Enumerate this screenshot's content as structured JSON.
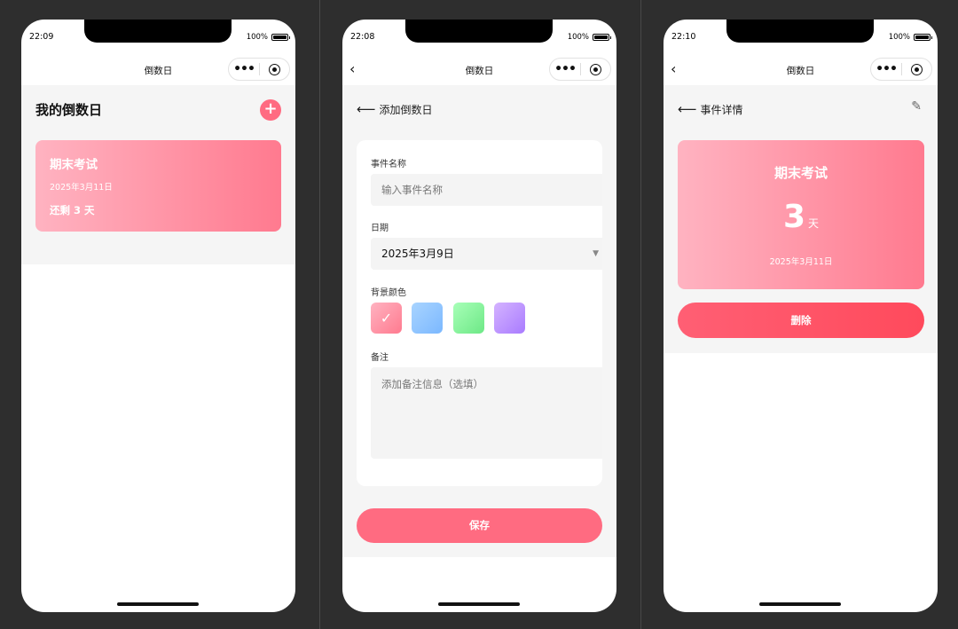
{
  "screens": [
    {
      "status_time": "22:09",
      "battery": "100%",
      "nav_title": "倒数日",
      "page_title": "我的倒数日",
      "add_symbol": "+",
      "event": {
        "name": "期末考试",
        "date": "2025年3月11日",
        "remaining": "还剩 3 天"
      }
    },
    {
      "status_time": "22:08",
      "battery": "100%",
      "nav_title": "倒数日",
      "page_title": "添加倒数日",
      "form": {
        "name_label": "事件名称",
        "name_placeholder": "输入事件名称",
        "date_label": "日期",
        "date_value": "2025年3月9日",
        "color_label": "背景颜色",
        "colors": [
          {
            "name": "pink",
            "from": "#ffb3c1",
            "to": "#ff7a8f",
            "selected": true
          },
          {
            "name": "blue",
            "from": "#a9d4ff",
            "to": "#7bb8ff",
            "selected": false
          },
          {
            "name": "green",
            "from": "#a8ffb8",
            "to": "#6de886",
            "selected": false
          },
          {
            "name": "purple",
            "from": "#d4b3ff",
            "to": "#a97bff",
            "selected": false
          }
        ],
        "check": "✓",
        "note_label": "备注",
        "note_placeholder": "添加备注信息（选填）"
      },
      "save_label": "保存"
    },
    {
      "status_time": "22:10",
      "battery": "100%",
      "nav_title": "倒数日",
      "page_title": "事件详情",
      "detail": {
        "name": "期末考试",
        "days": "3",
        "unit": "天",
        "date": "2025年3月11日"
      },
      "delete_label": "删除"
    }
  ],
  "icons": {
    "back": "chevron-left-icon",
    "more": "more-dots-icon",
    "close": "target-icon",
    "edit": "pencil-icon",
    "add": "plus-icon"
  },
  "colors": {
    "accent": "#ff6b81",
    "danger": "#ff4a5c",
    "page_bg": "#f5f5f5"
  }
}
